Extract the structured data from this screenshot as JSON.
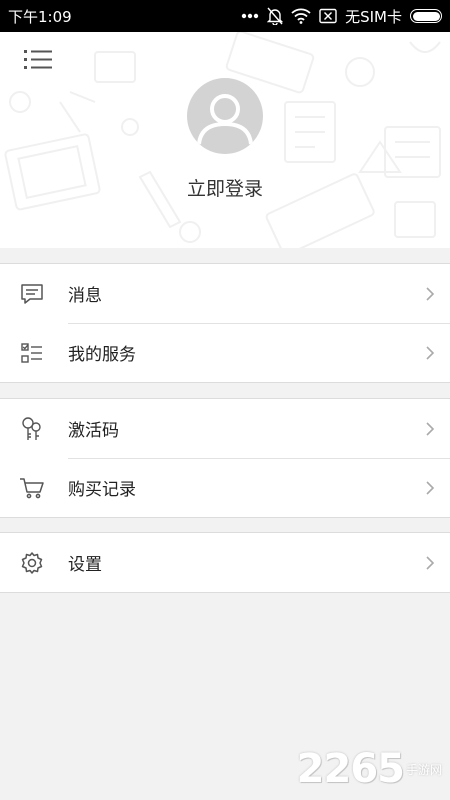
{
  "status_bar": {
    "time": "下午1:09",
    "carrier": "无SIM卡",
    "icons": [
      "more-dots-icon",
      "bell-off-icon",
      "wifi-icon",
      "sim-off-icon",
      "battery-icon"
    ]
  },
  "header": {
    "menu_icon": "menu-list-icon",
    "avatar_icon": "user-avatar-icon",
    "login_label": "立即登录"
  },
  "menu_groups": [
    {
      "items": [
        {
          "label": "消息",
          "icon": "message-icon"
        },
        {
          "label": "我的服务",
          "icon": "checklist-icon"
        }
      ]
    },
    {
      "items": [
        {
          "label": "激活码",
          "icon": "key-icon"
        },
        {
          "label": "购买记录",
          "icon": "cart-icon"
        }
      ]
    },
    {
      "items": [
        {
          "label": "设置",
          "icon": "gear-icon"
        }
      ]
    }
  ],
  "watermark": {
    "number": "2265",
    "text": "手游网"
  },
  "colors": {
    "status_bar": "#000000",
    "page_bg": "#f2f2f2",
    "avatar_bg": "#d3d3d3",
    "icon": "#555555"
  }
}
